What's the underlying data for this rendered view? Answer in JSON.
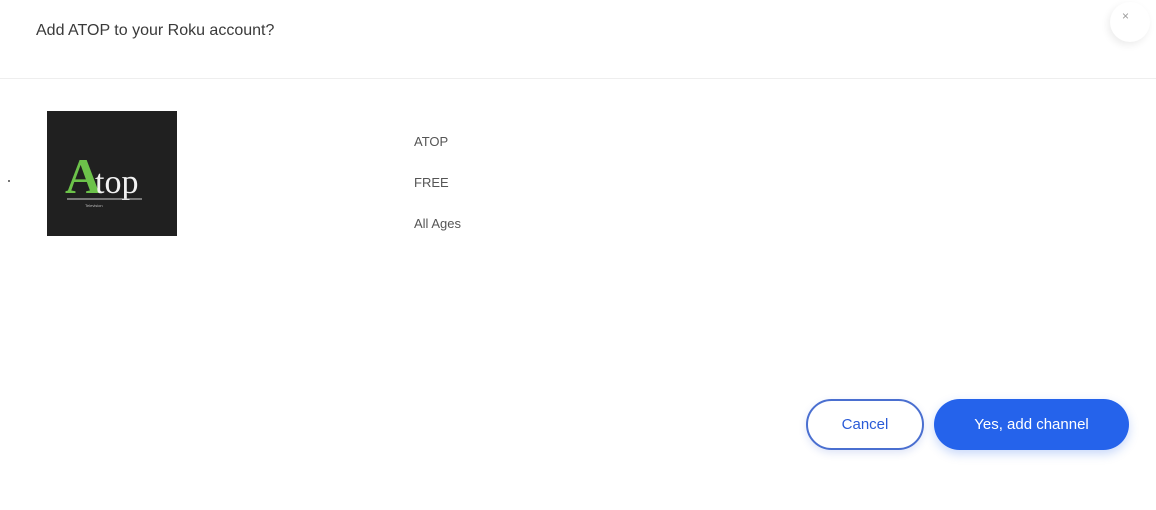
{
  "dialog": {
    "title": "Add ATOP to your Roku account?",
    "close_icon": "close-icon",
    "close_glyph": "×"
  },
  "channel": {
    "logo": {
      "icon": "atop-logo",
      "letter": "A",
      "rest": "top",
      "tagline": "Television",
      "accent_color": "#6cc24a",
      "background_color": "#202020"
    },
    "name": "ATOP",
    "price": "FREE",
    "rating": "All Ages"
  },
  "actions": {
    "cancel_label": "Cancel",
    "confirm_label": "Yes, add channel",
    "primary_color": "#2563eb"
  }
}
